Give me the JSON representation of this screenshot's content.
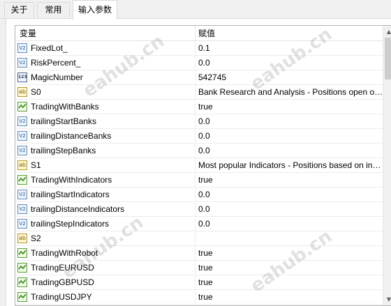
{
  "tabs": [
    {
      "label": "关于",
      "active": false
    },
    {
      "label": "常用",
      "active": false
    },
    {
      "label": "输入参数",
      "active": true
    }
  ],
  "grid": {
    "columns": {
      "variable": "变量",
      "value": "赋值"
    },
    "rows": [
      {
        "type": "double-icon",
        "icon_text": "V2",
        "name": "FixedLot_",
        "value": "0.1"
      },
      {
        "type": "double-icon",
        "icon_text": "V2",
        "name": "RiskPercent_",
        "value": "0.0"
      },
      {
        "type": "int-icon",
        "icon_text": "123",
        "name": "MagicNumber",
        "value": "542745"
      },
      {
        "type": "string-icon",
        "icon_text": "ab",
        "name": "S0",
        "value": "Bank Research and Analysis - Positions open on the basis of bank analysis"
      },
      {
        "type": "bool-icon",
        "icon_text": "",
        "name": "TradingWithBanks",
        "value": "true"
      },
      {
        "type": "double-icon",
        "icon_text": "V2",
        "name": "trailingStartBanks",
        "value": "0.0"
      },
      {
        "type": "double-icon",
        "icon_text": "V2",
        "name": "trailingDistanceBanks",
        "value": "0.0"
      },
      {
        "type": "double-icon",
        "icon_text": "V2",
        "name": "trailingStepBanks",
        "value": "0.0"
      },
      {
        "type": "string-icon",
        "icon_text": "ab",
        "name": "S1",
        "value": "Most popular Indicators - Positions based on indicators"
      },
      {
        "type": "bool-icon",
        "icon_text": "",
        "name": "TradingWithIndicators",
        "value": "true"
      },
      {
        "type": "double-icon",
        "icon_text": "V2",
        "name": "trailingStartIndicators",
        "value": "0.0"
      },
      {
        "type": "double-icon",
        "icon_text": "V2",
        "name": "trailingDistanceIndicators",
        "value": "0.0"
      },
      {
        "type": "double-icon",
        "icon_text": "V2",
        "name": "trailingStepIndicators",
        "value": "0.0"
      },
      {
        "type": "string-icon",
        "icon_text": "ab",
        "name": "S2",
        "value": ""
      },
      {
        "type": "bool-icon",
        "icon_text": "",
        "name": "TradingWithRobot",
        "value": "true"
      },
      {
        "type": "bool-icon",
        "icon_text": "",
        "name": "TradingEURUSD",
        "value": "true"
      },
      {
        "type": "bool-icon",
        "icon_text": "",
        "name": "TradingGBPUSD",
        "value": "true"
      },
      {
        "type": "bool-icon",
        "icon_text": "",
        "name": "TradingUSDJPY",
        "value": "true"
      }
    ]
  },
  "scrollbar": {
    "up_icon": "▲",
    "down_icon": "▼"
  },
  "watermarks": [
    "eahub.cn",
    "eahub.cn",
    "eahub.cn",
    "eahub.cn"
  ]
}
